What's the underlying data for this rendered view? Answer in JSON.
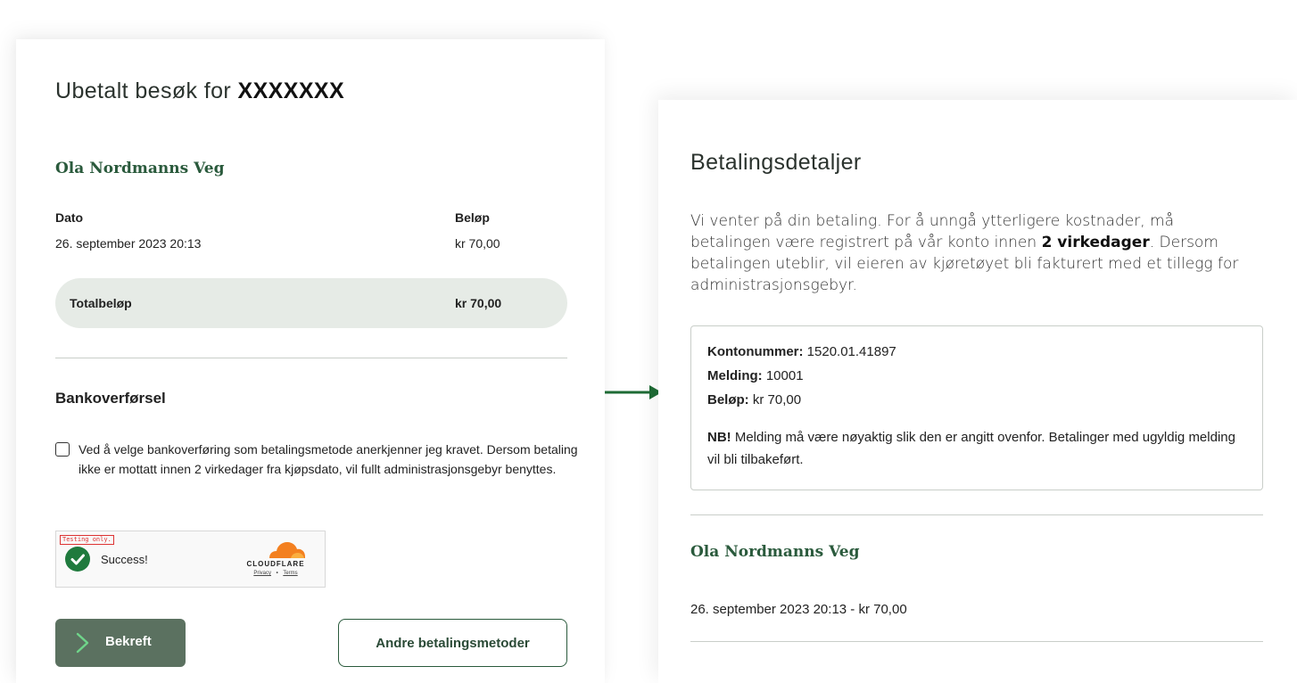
{
  "left": {
    "title_prefix": "Ubetalt besøk for",
    "title_plate": "XXXXXXX",
    "location": "Ola Nordmanns Veg",
    "columns": {
      "date_header": "Dato",
      "amount_header": "Beløp"
    },
    "row": {
      "date": "26. september 2023 20:13",
      "amount": "kr 70,00"
    },
    "total": {
      "label": "Totalbeløp",
      "amount": "kr 70,00"
    },
    "payment_method_title": "Bankoverførsel",
    "consent_text": "Ved å velge bankoverføring som betalingsmetode anerkjenner jeg kravet. Dersom betaling ikke er mottatt innen 2 virkedager fra kjøpsdato, vil fullt administrasjonsgebyr benyttes.",
    "consent_checked": false,
    "captcha": {
      "testing_label": "Testing only.",
      "status": "Success!",
      "brand": "CLOUDFLARE",
      "privacy": "Privacy",
      "separator": "•",
      "terms": "Terms"
    },
    "confirm_label": "Bekreft",
    "other_methods_label": "Andre betalingsmetoder"
  },
  "right": {
    "title": "Betalingsdetaljer",
    "intro_before": "Vi venter på din betaling. For å unngå ytterligere kostnader, må betalingen være registrert på vår konto innen",
    "intro_bold": "2 virkedager",
    "intro_after": ". Dersom betalingen uteblir, vil eieren av kjøretøyet bli fakturert med et tillegg for administrasjonsgebyr.",
    "account_label": "Kontonummer:",
    "account_value": "1520.01.41897",
    "message_label": "Melding:",
    "message_value": "10001",
    "amount_label": "Beløp:",
    "amount_value": "kr 70,00",
    "nb_label": "NB!",
    "nb_text": "Melding må være nøyaktig slik den er angitt ovenfor. Betalinger med ugyldig melding vil bli tilbakeført.",
    "location": "Ola Nordmanns Veg",
    "summary": "26. september 2023 20:13 - kr 70,00"
  },
  "colors": {
    "brand_green": "#2a5a3c",
    "button_green": "#5b7160",
    "arrow_green": "#1e6b35",
    "total_bg": "#e6ebe6",
    "cloudflare_orange": "#f38020"
  },
  "icons": [
    "chevron-right-icon",
    "checkmark-icon",
    "cloudflare-logo",
    "arrow-right-icon"
  ]
}
